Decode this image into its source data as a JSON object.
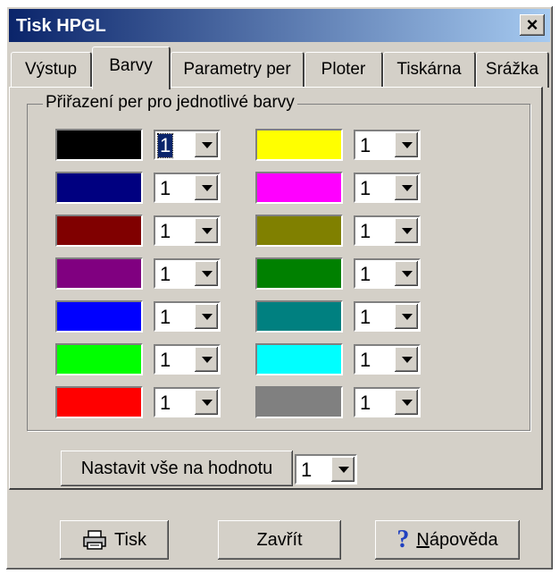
{
  "window": {
    "title": "Tisk HPGL",
    "close_label": "×"
  },
  "tabs": [
    {
      "label": "Výstup"
    },
    {
      "label": "Barvy",
      "active": true
    },
    {
      "label": "Parametry per"
    },
    {
      "label": "Ploter"
    },
    {
      "label": "Tiskárna"
    },
    {
      "label": "Srážka"
    }
  ],
  "group": {
    "label": "Přiřazení per pro jednotlivé barvy",
    "left_colors": [
      {
        "color": "#000000",
        "pen": "1"
      },
      {
        "color": "#000080",
        "pen": "1"
      },
      {
        "color": "#800000",
        "pen": "1"
      },
      {
        "color": "#800080",
        "pen": "1"
      },
      {
        "color": "#0000ff",
        "pen": "1"
      },
      {
        "color": "#00ff00",
        "pen": "1"
      },
      {
        "color": "#ff0000",
        "pen": "1"
      }
    ],
    "right_colors": [
      {
        "color": "#ffff00",
        "pen": "1"
      },
      {
        "color": "#ff00ff",
        "pen": "1"
      },
      {
        "color": "#808000",
        "pen": "1"
      },
      {
        "color": "#008000",
        "pen": "1"
      },
      {
        "color": "#008080",
        "pen": "1"
      },
      {
        "color": "#00ffff",
        "pen": "1"
      },
      {
        "color": "#808080",
        "pen": "1"
      }
    ]
  },
  "set_all": {
    "button_label": "Nastavit vše na hodnotu",
    "value": "1"
  },
  "footer": {
    "print_label": "Tisk",
    "close_label": "Zavřít",
    "help_label": "Nápověda"
  }
}
